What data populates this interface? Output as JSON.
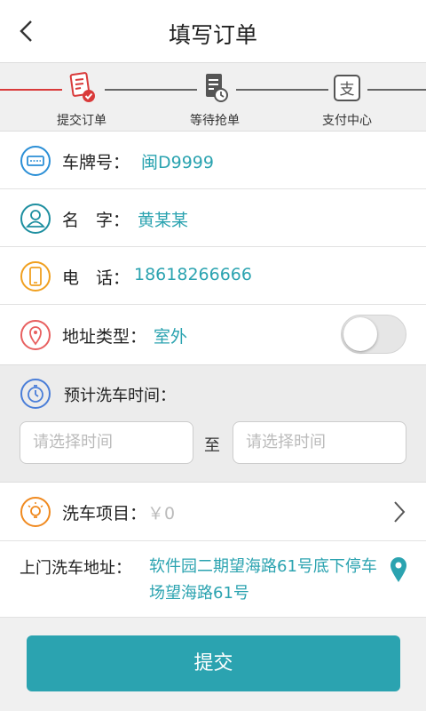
{
  "header": {
    "title": "填写订单"
  },
  "steps": [
    {
      "label": "提交订单"
    },
    {
      "label": "等待抢单"
    },
    {
      "label": "支付中心"
    }
  ],
  "form": {
    "plate": {
      "label": "车牌号：",
      "value": "闽D9999"
    },
    "name": {
      "label": "名　字：",
      "value": "黄某某"
    },
    "phone": {
      "label": "电　话：",
      "value": "18618266666"
    },
    "addr_type": {
      "label": "地址类型：",
      "value": "室外",
      "toggle_on": false
    }
  },
  "time": {
    "label": "预计洗车时间：",
    "start_placeholder": "请选择时间",
    "end_placeholder": "请选择时间",
    "to": "至"
  },
  "project": {
    "label": "洗车项目：",
    "value": "￥0"
  },
  "address": {
    "label": "上门洗车地址：",
    "value": "软件园二期望海路61号底下停车场望海路61号"
  },
  "submit": {
    "label": "提交"
  },
  "colors": {
    "accent": "#2ba3b0",
    "step_active": "#d93a3a"
  }
}
